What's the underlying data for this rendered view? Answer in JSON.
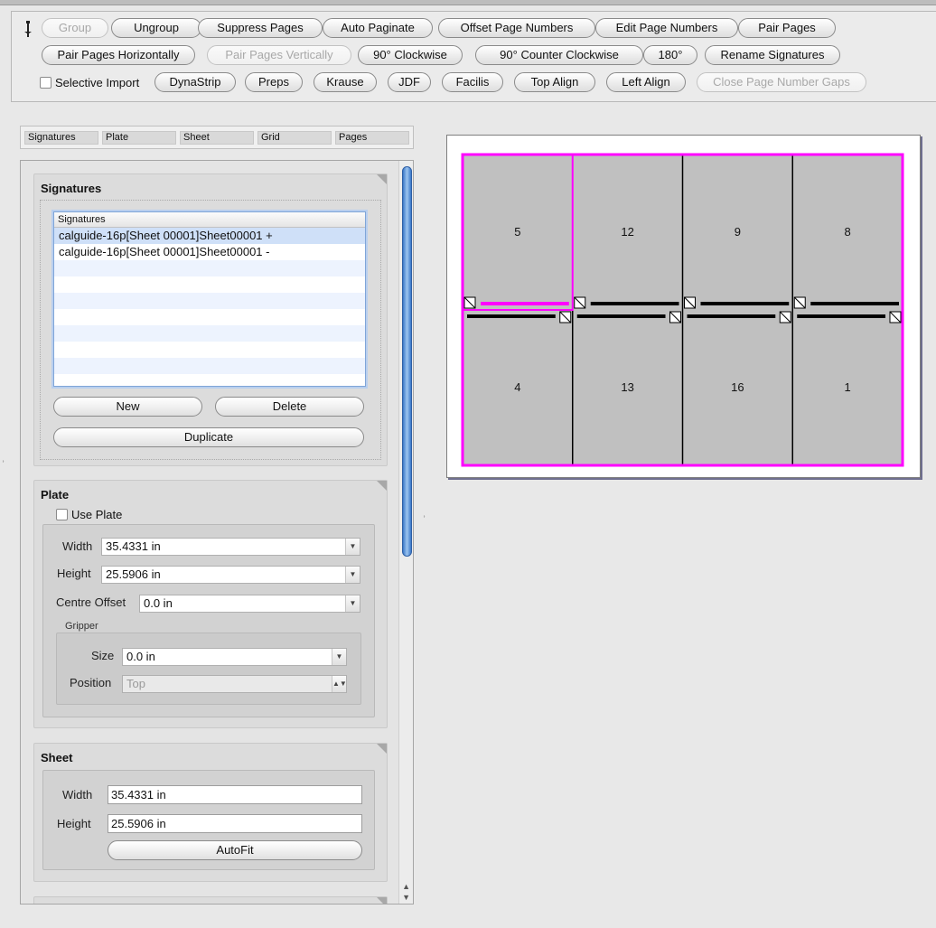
{
  "toolbar": {
    "row1": [
      {
        "label": "Group",
        "disabled": true
      },
      {
        "label": "Ungroup",
        "disabled": false
      },
      {
        "label": "Suppress Pages",
        "disabled": false
      },
      {
        "label": "Auto Paginate",
        "disabled": false
      },
      {
        "label": "Offset Page Numbers",
        "disabled": false
      },
      {
        "label": "Edit Page Numbers",
        "disabled": false
      },
      {
        "label": "Pair Pages",
        "disabled": false
      }
    ],
    "row2": [
      {
        "label": "Pair Pages Horizontally",
        "disabled": false
      },
      {
        "label": "Pair Pages Vertically",
        "disabled": true
      },
      {
        "label": "90° Clockwise",
        "disabled": false
      },
      {
        "label": "90° Counter Clockwise",
        "disabled": false
      },
      {
        "label": "180°",
        "disabled": false
      },
      {
        "label": "Rename Signatures",
        "disabled": false
      }
    ],
    "selective_import_label": "Selective Import",
    "row3": [
      {
        "label": "DynaStrip",
        "disabled": false
      },
      {
        "label": "Preps",
        "disabled": false
      },
      {
        "label": "Krause",
        "disabled": false
      },
      {
        "label": "JDF",
        "disabled": false
      },
      {
        "label": "Facilis",
        "disabled": false
      },
      {
        "label": "Top Align",
        "disabled": false
      },
      {
        "label": "Left Align",
        "disabled": false
      },
      {
        "label": "Close Page Number Gaps",
        "disabled": true
      }
    ]
  },
  "tabs": [
    "Signatures",
    "Plate",
    "Sheet",
    "Grid",
    "Pages"
  ],
  "signatures": {
    "title": "Signatures",
    "list_header": "Signatures",
    "items": [
      "calguide-16p[Sheet 00001]Sheet00001 +",
      "calguide-16p[Sheet 00001]Sheet00001 -"
    ],
    "new_label": "New",
    "delete_label": "Delete",
    "duplicate_label": "Duplicate"
  },
  "plate": {
    "title": "Plate",
    "use_plate_label": "Use Plate",
    "width_label": "Width",
    "width_value": "35.4331 in",
    "height_label": "Height",
    "height_value": "25.5906 in",
    "centre_offset_label": "Centre Offset",
    "centre_offset_value": "0.0 in",
    "gripper_label": "Gripper",
    "size_label": "Size",
    "size_value": "0.0 in",
    "position_label": "Position",
    "position_value": "Top"
  },
  "sheet": {
    "title": "Sheet",
    "width_label": "Width",
    "width_value": "35.4331 in",
    "height_label": "Height",
    "height_value": "25.5906 in",
    "autofit_label": "AutoFit"
  },
  "layout": {
    "top_row": [
      "5",
      "12",
      "9",
      "8"
    ],
    "bottom_row": [
      "4",
      "13",
      "16",
      "1"
    ],
    "accent_color": "#ff00ff",
    "page_fill": "#c0c0c0"
  }
}
